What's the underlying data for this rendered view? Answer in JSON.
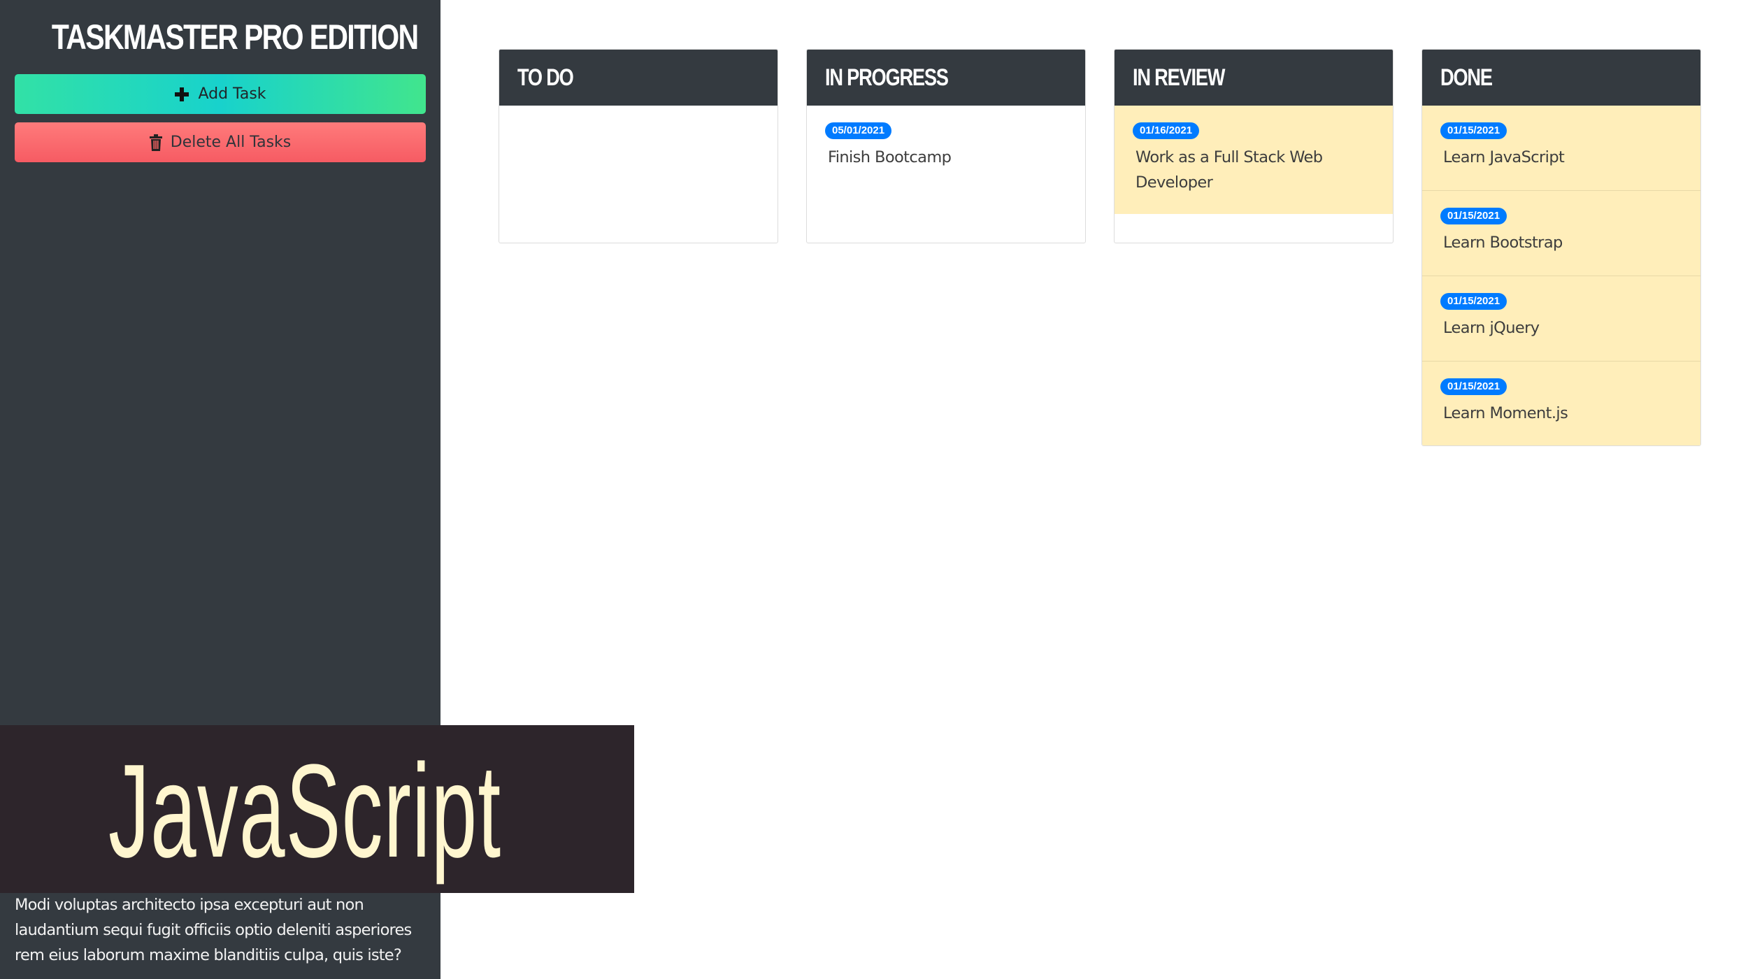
{
  "app": {
    "title": "TASKMASTER PRO EDITION"
  },
  "sidebar": {
    "add_button_label": "Add Task",
    "delete_button_label": "Delete All Tasks",
    "add_icon": "plus-icon",
    "delete_icon": "trash-icon",
    "text": "Modi voluptas architecto ipsa excepturi aut non laudantium sequi fugit officiis optio deleniti asperiores rem eius laborum maxime blanditiis culpa, quis iste?"
  },
  "banner": {
    "text": "JavaScript"
  },
  "colors": {
    "sidebar_bg": "#343a40",
    "column_header_bg": "#343a40",
    "card_bg": "#ffeeba",
    "badge_bg": "#007bff",
    "add_button": "#32e1a6",
    "delete_button": "#f65b63",
    "banner_bg": "#2d252b",
    "banner_text": "#fff6cf"
  },
  "columns": [
    {
      "title": "TO DO",
      "tasks": []
    },
    {
      "title": "IN PROGRESS",
      "tasks": [
        {
          "date": "05/01/2021",
          "text": "Finish Bootcamp"
        }
      ]
    },
    {
      "title": "IN REVIEW",
      "tasks": [
        {
          "date": "01/16/2021",
          "text": "Work as a Full Stack Web Developer"
        }
      ]
    },
    {
      "title": "DONE",
      "tasks": [
        {
          "date": "01/15/2021",
          "text": "Learn JavaScript"
        },
        {
          "date": "01/15/2021",
          "text": "Learn Bootstrap"
        },
        {
          "date": "01/15/2021",
          "text": "Learn jQuery"
        },
        {
          "date": "01/15/2021",
          "text": "Learn Moment.js"
        }
      ]
    }
  ]
}
